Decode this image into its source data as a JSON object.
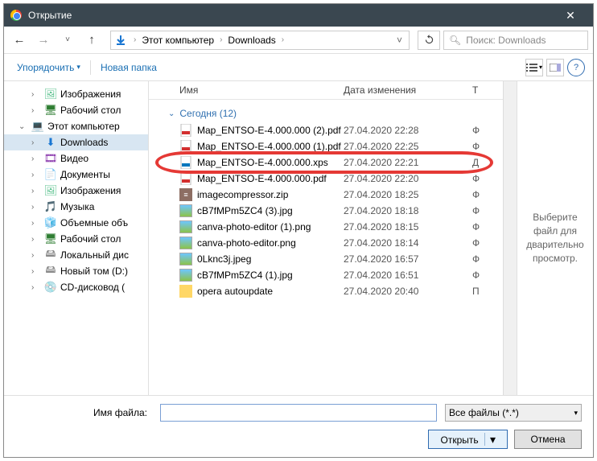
{
  "title": "Открытие",
  "breadcrumb": {
    "pc": "Этот компьютер",
    "folder": "Downloads"
  },
  "search": {
    "placeholder": "Поиск: Downloads"
  },
  "toolbar": {
    "organize": "Упорядочить",
    "newfolder": "Новая папка"
  },
  "columns": {
    "name": "Имя",
    "date": "Дата изменения",
    "type": "Т"
  },
  "group": {
    "label": "Сегодня (12)"
  },
  "tree": [
    {
      "label": "Изображения",
      "icon": "images",
      "level": 2
    },
    {
      "label": "Рабочий стол",
      "icon": "desktop",
      "level": 2
    },
    {
      "label": "Этот компьютер",
      "icon": "pc",
      "level": 1,
      "expanded": true
    },
    {
      "label": "Downloads",
      "icon": "dl",
      "level": 2,
      "selected": true
    },
    {
      "label": "Видео",
      "icon": "video",
      "level": 2
    },
    {
      "label": "Документы",
      "icon": "doc",
      "level": 2
    },
    {
      "label": "Изображения",
      "icon": "images",
      "level": 2
    },
    {
      "label": "Музыка",
      "icon": "music",
      "level": 2
    },
    {
      "label": "Объемные объ",
      "icon": "3d",
      "level": 2
    },
    {
      "label": "Рабочий стол",
      "icon": "desktop",
      "level": 2
    },
    {
      "label": "Локальный дис",
      "icon": "disk",
      "level": 2
    },
    {
      "label": "Новый том (D:)",
      "icon": "disk",
      "level": 2
    },
    {
      "label": "CD-дисковод (",
      "icon": "cd",
      "level": 2
    }
  ],
  "files": [
    {
      "name": "Map_ENTSO-E-4.000.000 (2).pdf",
      "date": "27.04.2020 22:28",
      "type": "Ф",
      "icon": "pdf"
    },
    {
      "name": "Map_ENTSO-E-4.000.000 (1).pdf",
      "date": "27.04.2020 22:25",
      "type": "Ф",
      "icon": "pdf"
    },
    {
      "name": "Map_ENTSO-E-4.000.000.xps",
      "date": "27.04.2020 22:21",
      "type": "Д",
      "icon": "xps",
      "highlight": true
    },
    {
      "name": "Map_ENTSO-E-4.000.000.pdf",
      "date": "27.04.2020 22:20",
      "type": "Ф",
      "icon": "pdf"
    },
    {
      "name": "imagecompressor.zip",
      "date": "27.04.2020 18:25",
      "type": "Ф",
      "icon": "zip"
    },
    {
      "name": "cB7fMPm5ZC4 (3).jpg",
      "date": "27.04.2020 18:18",
      "type": "Ф",
      "icon": "img"
    },
    {
      "name": "canva-photo-editor (1).png",
      "date": "27.04.2020 18:15",
      "type": "Ф",
      "icon": "img"
    },
    {
      "name": "canva-photo-editor.png",
      "date": "27.04.2020 18:14",
      "type": "Ф",
      "icon": "img"
    },
    {
      "name": "0Lknc3j.jpeg",
      "date": "27.04.2020 16:57",
      "type": "Ф",
      "icon": "img"
    },
    {
      "name": "cB7fMPm5ZC4 (1).jpg",
      "date": "27.04.2020 16:51",
      "type": "Ф",
      "icon": "img"
    },
    {
      "name": "opera autoupdate",
      "date": "27.04.2020 20:40",
      "type": "П",
      "icon": "fold"
    }
  ],
  "preview": {
    "text": "Выберите файл для дварительно просмотр."
  },
  "footer": {
    "filename_label": "Имя файла:",
    "filename_value": "",
    "filter": "Все файлы (*.*)",
    "open": "Открыть",
    "cancel": "Отмена"
  }
}
